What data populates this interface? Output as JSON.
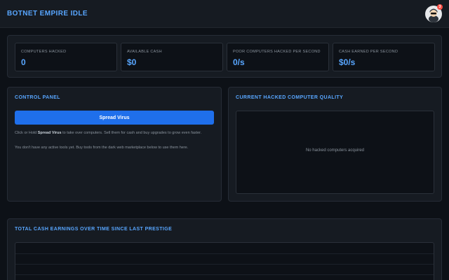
{
  "app": {
    "title": "BOTNET EMPIRE IDLE",
    "notification_count": "3"
  },
  "stats": [
    {
      "label": "COMPUTERS HACKED",
      "value": "0"
    },
    {
      "label": "AVAILABLE CASH",
      "value": "$0"
    },
    {
      "label": "POOR COMPUTERS HACKED PER SECOND",
      "value": "0/s"
    },
    {
      "label": "CASH EARNED PER SECOND",
      "value": "$0/s"
    }
  ],
  "control_panel": {
    "title": "CONTROL PANEL",
    "button_label": "Spread Virus",
    "help_prefix": "Click or Hold ",
    "help_bold": "Spread Virus",
    "help_suffix": " to take over computers. Sell them for cash and buy upgrades to grow even faster.",
    "tools_text": "You don't have any active tools yet. Buy tools from the dark web marketplace below to use them here."
  },
  "quality_panel": {
    "title": "CURRENT HACKED COMPUTER QUALITY",
    "empty_message": "No hacked computers acquired"
  },
  "earnings_panel": {
    "title": "TOTAL CASH EARNINGS OVER TIME SINCE LAST PRESTIGE"
  },
  "colors": {
    "background": "#0d1117",
    "panel": "#161b22",
    "accent": "#58a6ff",
    "button": "#1f6feb",
    "badge": "#f85149"
  },
  "icons": {
    "avatar": "hacker-avatar-icon"
  }
}
